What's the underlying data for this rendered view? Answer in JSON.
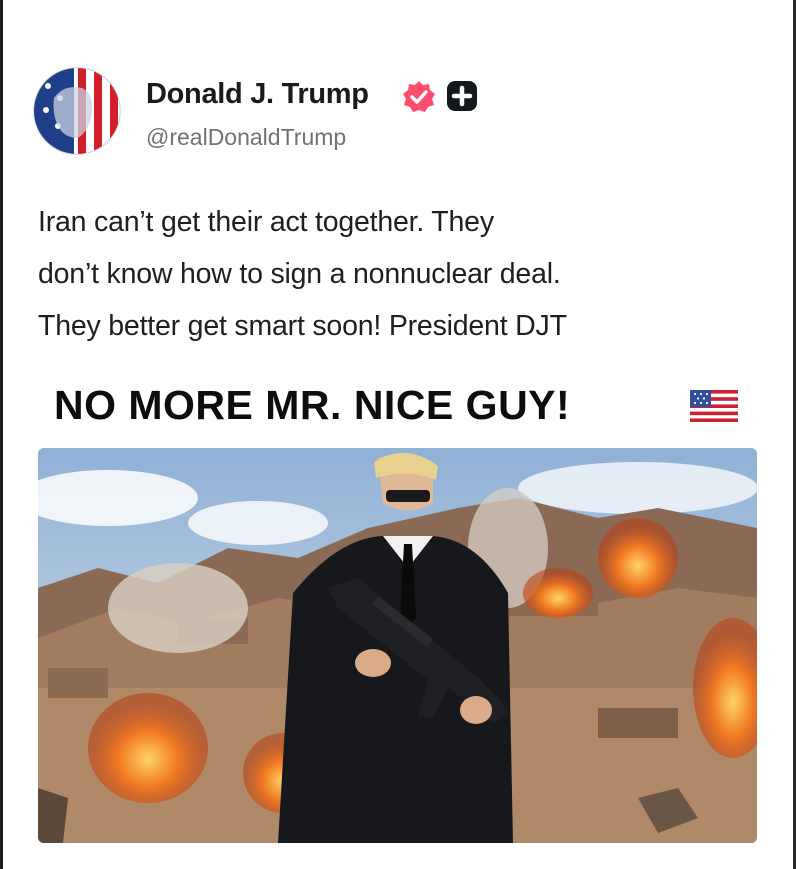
{
  "post": {
    "author": {
      "display_name": "Donald J. Trump",
      "handle": "@realDonaldTrump",
      "avatar_icon": "flag-portrait-avatar",
      "verified_icon": "verified-badge-icon",
      "verified_color": "#ff4d6d",
      "plus_icon": "plus-badge-icon"
    },
    "text_lines": [
      "Iran can’t get their act together. They",
      "don’t know how to sign a nonnuclear deal.",
      "They better get smart soon! President DJT"
    ],
    "headline": "NO MORE MR. NICE GUY!",
    "headline_icon": "us-flag-icon",
    "media": {
      "type": "image",
      "icon": "photo-man-with-rifle-explosions"
    }
  }
}
